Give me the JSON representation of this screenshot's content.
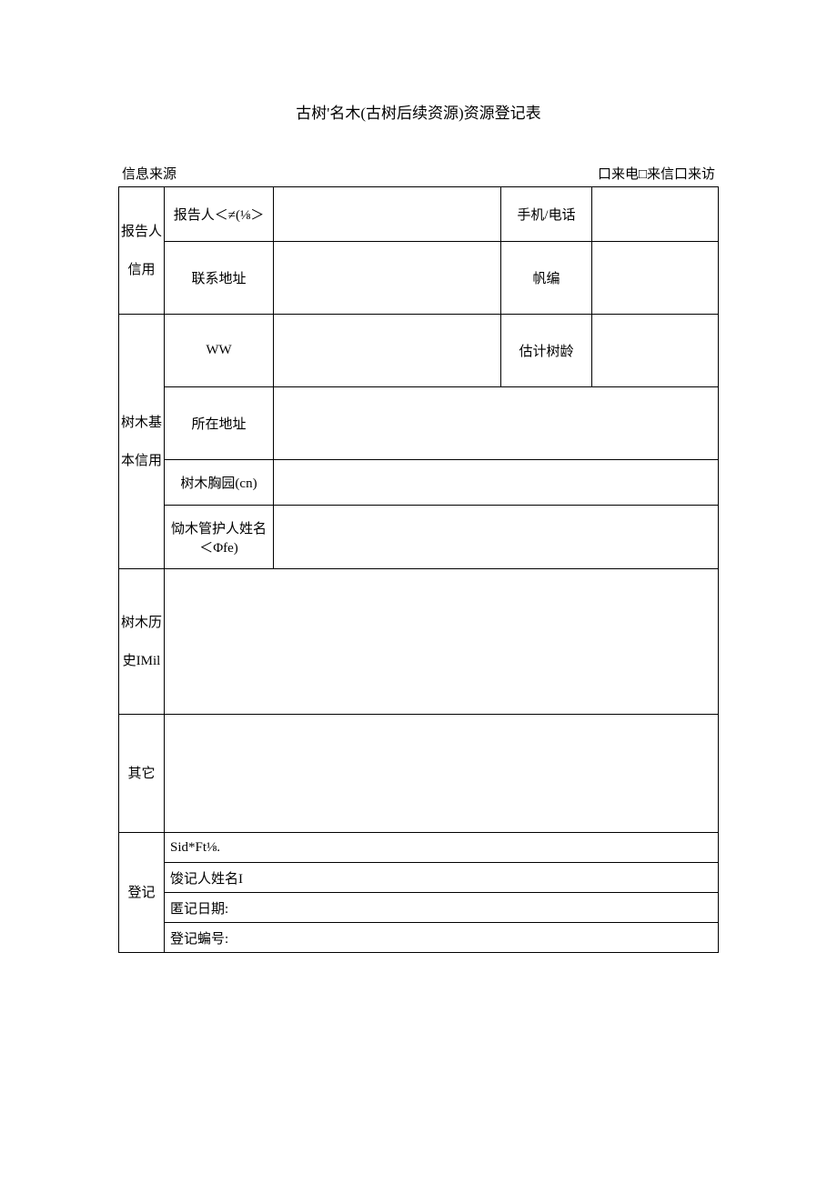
{
  "title": "古树'名木(古树后续资源)资源登记表",
  "header": {
    "left_label": "信息来源",
    "right_label": "口来电□来信口来访"
  },
  "groups": {
    "reporter": "报告人信用",
    "tree": "树木基本信用",
    "history": "树木历史IMil",
    "other": "其它",
    "register": "登记"
  },
  "rows": {
    "reporter_name_label": "报告人＜≠(⅛＞",
    "phone_label": "手机/电话",
    "contact_addr_label": "联系地址",
    "postcode_label": "帆编",
    "ww_label": "WW",
    "est_age_label": "估计树龄",
    "location_label": "所在地址",
    "girth_label": "树木胸园(cn)",
    "caretaker_label": "恸木管护人姓名＜Φfe)"
  },
  "register_rows": {
    "r1": "Sid*Ft⅛.",
    "r2": "馂记人姓名I",
    "r3": "匿记日期:",
    "r4": "登记蝙号:"
  }
}
